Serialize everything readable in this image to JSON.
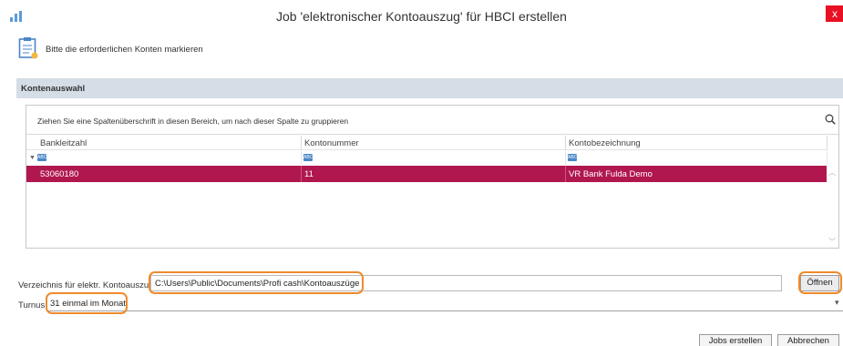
{
  "window": {
    "title": "Job 'elektronischer Kontoauszug' für HBCI erstellen",
    "close_glyph": "x"
  },
  "hint": "Bitte die erforderlichen Konten markieren",
  "section": {
    "label": "Kontenauswahl"
  },
  "grid": {
    "group_hint": "Ziehen Sie eine Spaltenüberschrift in diesen Bereich, um nach dieser Spalte zu gruppieren",
    "columns": [
      "Bankleitzahl",
      "Kontonummer",
      "Kontobezeichnung"
    ],
    "filter_icon_text": "ABC",
    "rows": [
      {
        "bankleitzahl": "53060180",
        "kontonummer": "11",
        "kontobezeichnung": "VR Bank Fulda Demo",
        "selected": true
      }
    ],
    "selected_row_color": "#b0174f"
  },
  "directory": {
    "label": "Verzeichnis für elektr. Kontoauszug",
    "value": "C:\\Users\\Public\\Documents\\Profi cash\\Kontoauszüge",
    "open_button": "Öffnen"
  },
  "turnus": {
    "label": "Turnus",
    "value": "31 einmal im Monat"
  },
  "buttons": {
    "create": "Jobs erstellen",
    "cancel": "Abbrechen"
  },
  "colors": {
    "highlight": "#ef8a2c",
    "section_header": "#d5dde6",
    "accent": "#4a86c8"
  },
  "icons": {
    "app": "bar-chart-icon",
    "hint": "clipboard-icon",
    "search": "search-icon",
    "filter": "filter-icon",
    "dropdown": "chevron-down-icon"
  }
}
